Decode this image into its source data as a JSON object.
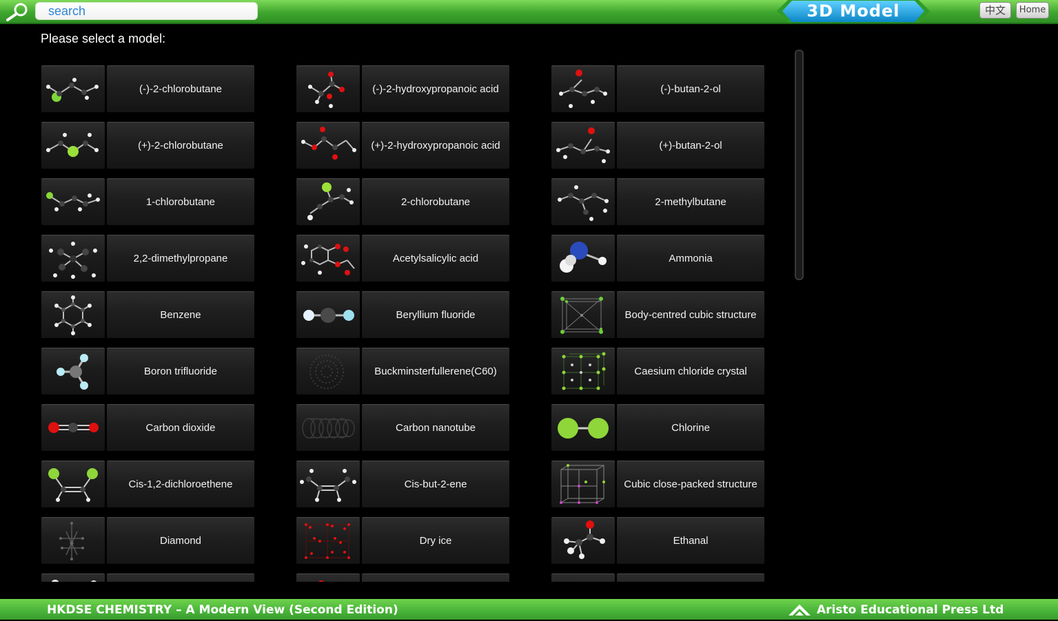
{
  "header": {
    "search_placeholder": "search",
    "title": "3D Model",
    "lang_button": "中文",
    "home_button": "Home"
  },
  "prompt": "Please select a model:",
  "models": [
    {
      "label": "(-)-2-chlorobutane",
      "icon": "chlorobutane-molecule-icon"
    },
    {
      "label": "(-)-2-hydroxypropanoic acid",
      "icon": "hydroxypropanoic-acid-molecule-icon"
    },
    {
      "label": "(-)-butan-2-ol",
      "icon": "butanol-molecule-icon"
    },
    {
      "label": "(+)-2-chlorobutane",
      "icon": "chlorobutane-molecule-icon"
    },
    {
      "label": "(+)-2-hydroxypropanoic acid",
      "icon": "hydroxypropanoic-acid-molecule-icon"
    },
    {
      "label": "(+)-butan-2-ol",
      "icon": "butanol-molecule-icon"
    },
    {
      "label": "1-chlorobutane",
      "icon": "chlorobutane-molecule-icon"
    },
    {
      "label": "2-chlorobutane",
      "icon": "chlorobutane-molecule-icon"
    },
    {
      "label": "2-methylbutane",
      "icon": "methylbutane-molecule-icon"
    },
    {
      "label": "2,2-dimethylpropane",
      "icon": "dimethylpropane-molecule-icon"
    },
    {
      "label": "Acetylsalicylic acid",
      "icon": "acetylsalicylic-acid-molecule-icon"
    },
    {
      "label": "Ammonia",
      "icon": "ammonia-molecule-icon"
    },
    {
      "label": "Benzene",
      "icon": "benzene-molecule-icon"
    },
    {
      "label": "Beryllium fluoride",
      "icon": "beryllium-fluoride-molecule-icon"
    },
    {
      "label": "Body-centred cubic structure",
      "icon": "bcc-lattice-icon"
    },
    {
      "label": "Boron trifluoride",
      "icon": "boron-trifluoride-molecule-icon"
    },
    {
      "label": "Buckminsterfullerene(C60)",
      "icon": "buckminsterfullerene-icon"
    },
    {
      "label": "Caesium chloride crystal",
      "icon": "caesium-chloride-lattice-icon"
    },
    {
      "label": "Carbon dioxide",
      "icon": "carbon-dioxide-molecule-icon"
    },
    {
      "label": "Carbon nanotube",
      "icon": "carbon-nanotube-icon"
    },
    {
      "label": "Chlorine",
      "icon": "chlorine-molecule-icon"
    },
    {
      "label": "Cis-1,2-dichloroethene",
      "icon": "dichloroethene-molecule-icon"
    },
    {
      "label": "Cis-but-2-ene",
      "icon": "butene-molecule-icon"
    },
    {
      "label": "Cubic close-packed structure",
      "icon": "ccp-lattice-icon"
    },
    {
      "label": "Diamond",
      "icon": "diamond-lattice-icon"
    },
    {
      "label": "Dry ice",
      "icon": "dry-ice-lattice-icon"
    },
    {
      "label": "Ethanal",
      "icon": "ethanal-molecule-icon"
    },
    {
      "label": "",
      "icon": "partial-molecule-icon"
    },
    {
      "label": "",
      "icon": "partial-molecule-icon"
    },
    {
      "label": "",
      "icon": "partial-molecule-icon"
    }
  ],
  "footer": {
    "left": "HKDSE CHEMISTRY – A Modern View (Second Edition)",
    "right": "Aristo Educational Press Ltd"
  },
  "colors": {
    "bar_green": "#48b33a",
    "title_badge": "#1aa3d9",
    "search_text": "#2f86d4"
  }
}
